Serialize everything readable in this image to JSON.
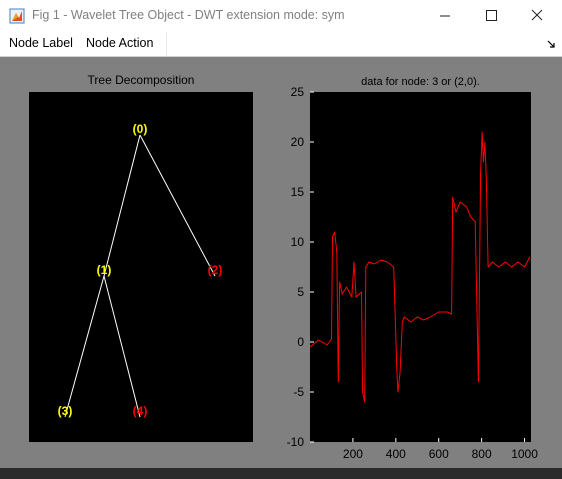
{
  "window": {
    "title": "Fig 1 - Wavelet Tree Object - DWT extension mode: sym",
    "controls": [
      "minimize",
      "maximize",
      "close"
    ]
  },
  "menu": {
    "items": [
      {
        "label": "Node Label"
      },
      {
        "label": "Node Action"
      }
    ]
  },
  "tree_panel": {
    "title": "Tree Decomposition",
    "nodes": [
      {
        "id": "0",
        "label": "(0)",
        "color": "#ffff00"
      },
      {
        "id": "1",
        "label": "(1)",
        "color": "#ffff00"
      },
      {
        "id": "2",
        "label": "(2)",
        "color": "#ff0000"
      },
      {
        "id": "3",
        "label": "(3)",
        "color": "#ffff00"
      },
      {
        "id": "4",
        "label": "(4)",
        "color": "#ff0000"
      }
    ],
    "edges": [
      [
        "0",
        "1"
      ],
      [
        "0",
        "2"
      ],
      [
        "1",
        "3"
      ],
      [
        "1",
        "4"
      ]
    ],
    "edge_color": "#ffffff",
    "background": "#000000"
  },
  "colors": {
    "figure_bg": "#808080",
    "axes_bg": "#000000",
    "signal": "#ff0000"
  },
  "chart_data": {
    "type": "line",
    "title": "data for node: 3 or (2,0).",
    "xlim": [
      0,
      1030
    ],
    "ylim": [
      -10,
      25
    ],
    "xticks": [
      200,
      400,
      600,
      800,
      1000
    ],
    "yticks": [
      -10,
      -5,
      0,
      5,
      10,
      15,
      20,
      25
    ],
    "grid": false,
    "series": [
      {
        "color": "#ff0000",
        "points": [
          [
            0,
            -0.5
          ],
          [
            40,
            0.2
          ],
          [
            80,
            -0.3
          ],
          [
            100,
            0.3
          ],
          [
            105,
            10.5
          ],
          [
            115,
            11
          ],
          [
            125,
            9
          ],
          [
            132,
            -4
          ],
          [
            138,
            6
          ],
          [
            150,
            4.8
          ],
          [
            170,
            5.5
          ],
          [
            195,
            4.5
          ],
          [
            205,
            8
          ],
          [
            215,
            4.5
          ],
          [
            240,
            5
          ],
          [
            245,
            -5
          ],
          [
            255,
            -6
          ],
          [
            260,
            7.5
          ],
          [
            275,
            8
          ],
          [
            300,
            7.8
          ],
          [
            330,
            8.2
          ],
          [
            360,
            8
          ],
          [
            390,
            7.5
          ],
          [
            405,
            -3
          ],
          [
            410,
            -5
          ],
          [
            420,
            -3
          ],
          [
            430,
            2
          ],
          [
            440,
            2.5
          ],
          [
            470,
            2
          ],
          [
            500,
            2.5
          ],
          [
            530,
            2.2
          ],
          [
            560,
            2.5
          ],
          [
            600,
            3
          ],
          [
            640,
            3
          ],
          [
            660,
            2.8
          ],
          [
            665,
            14.5
          ],
          [
            680,
            13
          ],
          [
            700,
            14
          ],
          [
            730,
            13.5
          ],
          [
            750,
            12.5
          ],
          [
            770,
            12
          ],
          [
            785,
            -4
          ],
          [
            795,
            17
          ],
          [
            802,
            21
          ],
          [
            808,
            18
          ],
          [
            815,
            20
          ],
          [
            822,
            16
          ],
          [
            830,
            7.5
          ],
          [
            850,
            8
          ],
          [
            880,
            7.5
          ],
          [
            910,
            8
          ],
          [
            940,
            7.5
          ],
          [
            970,
            8
          ],
          [
            1000,
            7.5
          ],
          [
            1024,
            8.5
          ]
        ]
      }
    ]
  }
}
